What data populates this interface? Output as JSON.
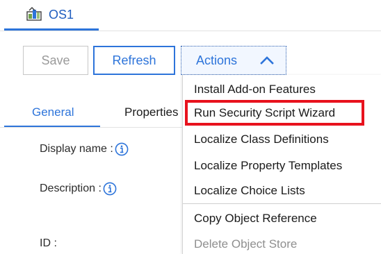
{
  "object_tab": {
    "title": "OS1",
    "icon": "object-store-icon",
    "accent": "#2d74da"
  },
  "toolbar": {
    "save_label": "Save",
    "refresh_label": "Refresh",
    "actions_label": "Actions",
    "actions_icon": "chevron-up-icon"
  },
  "subtabs": {
    "general": "General",
    "properties": "Properties"
  },
  "fields": {
    "display_name_label": "Display name :",
    "description_label": "Description :",
    "id_label": "ID :",
    "info_icon": "info-icon"
  },
  "actions_menu": {
    "items": [
      {
        "label": "Install Add-on Features",
        "enabled": true
      },
      {
        "label": "Run Security Script Wizard",
        "enabled": true,
        "highlighted": true
      },
      {
        "label": "Localize Class Definitions",
        "enabled": true
      },
      {
        "label": "Localize Property Templates",
        "enabled": true
      },
      {
        "label": "Localize Choice Lists",
        "enabled": true
      },
      {
        "label": "Copy Object Reference",
        "enabled": true
      },
      {
        "label": "Delete Object Store",
        "enabled": false
      }
    ],
    "highlight_color": "#e8121d"
  }
}
